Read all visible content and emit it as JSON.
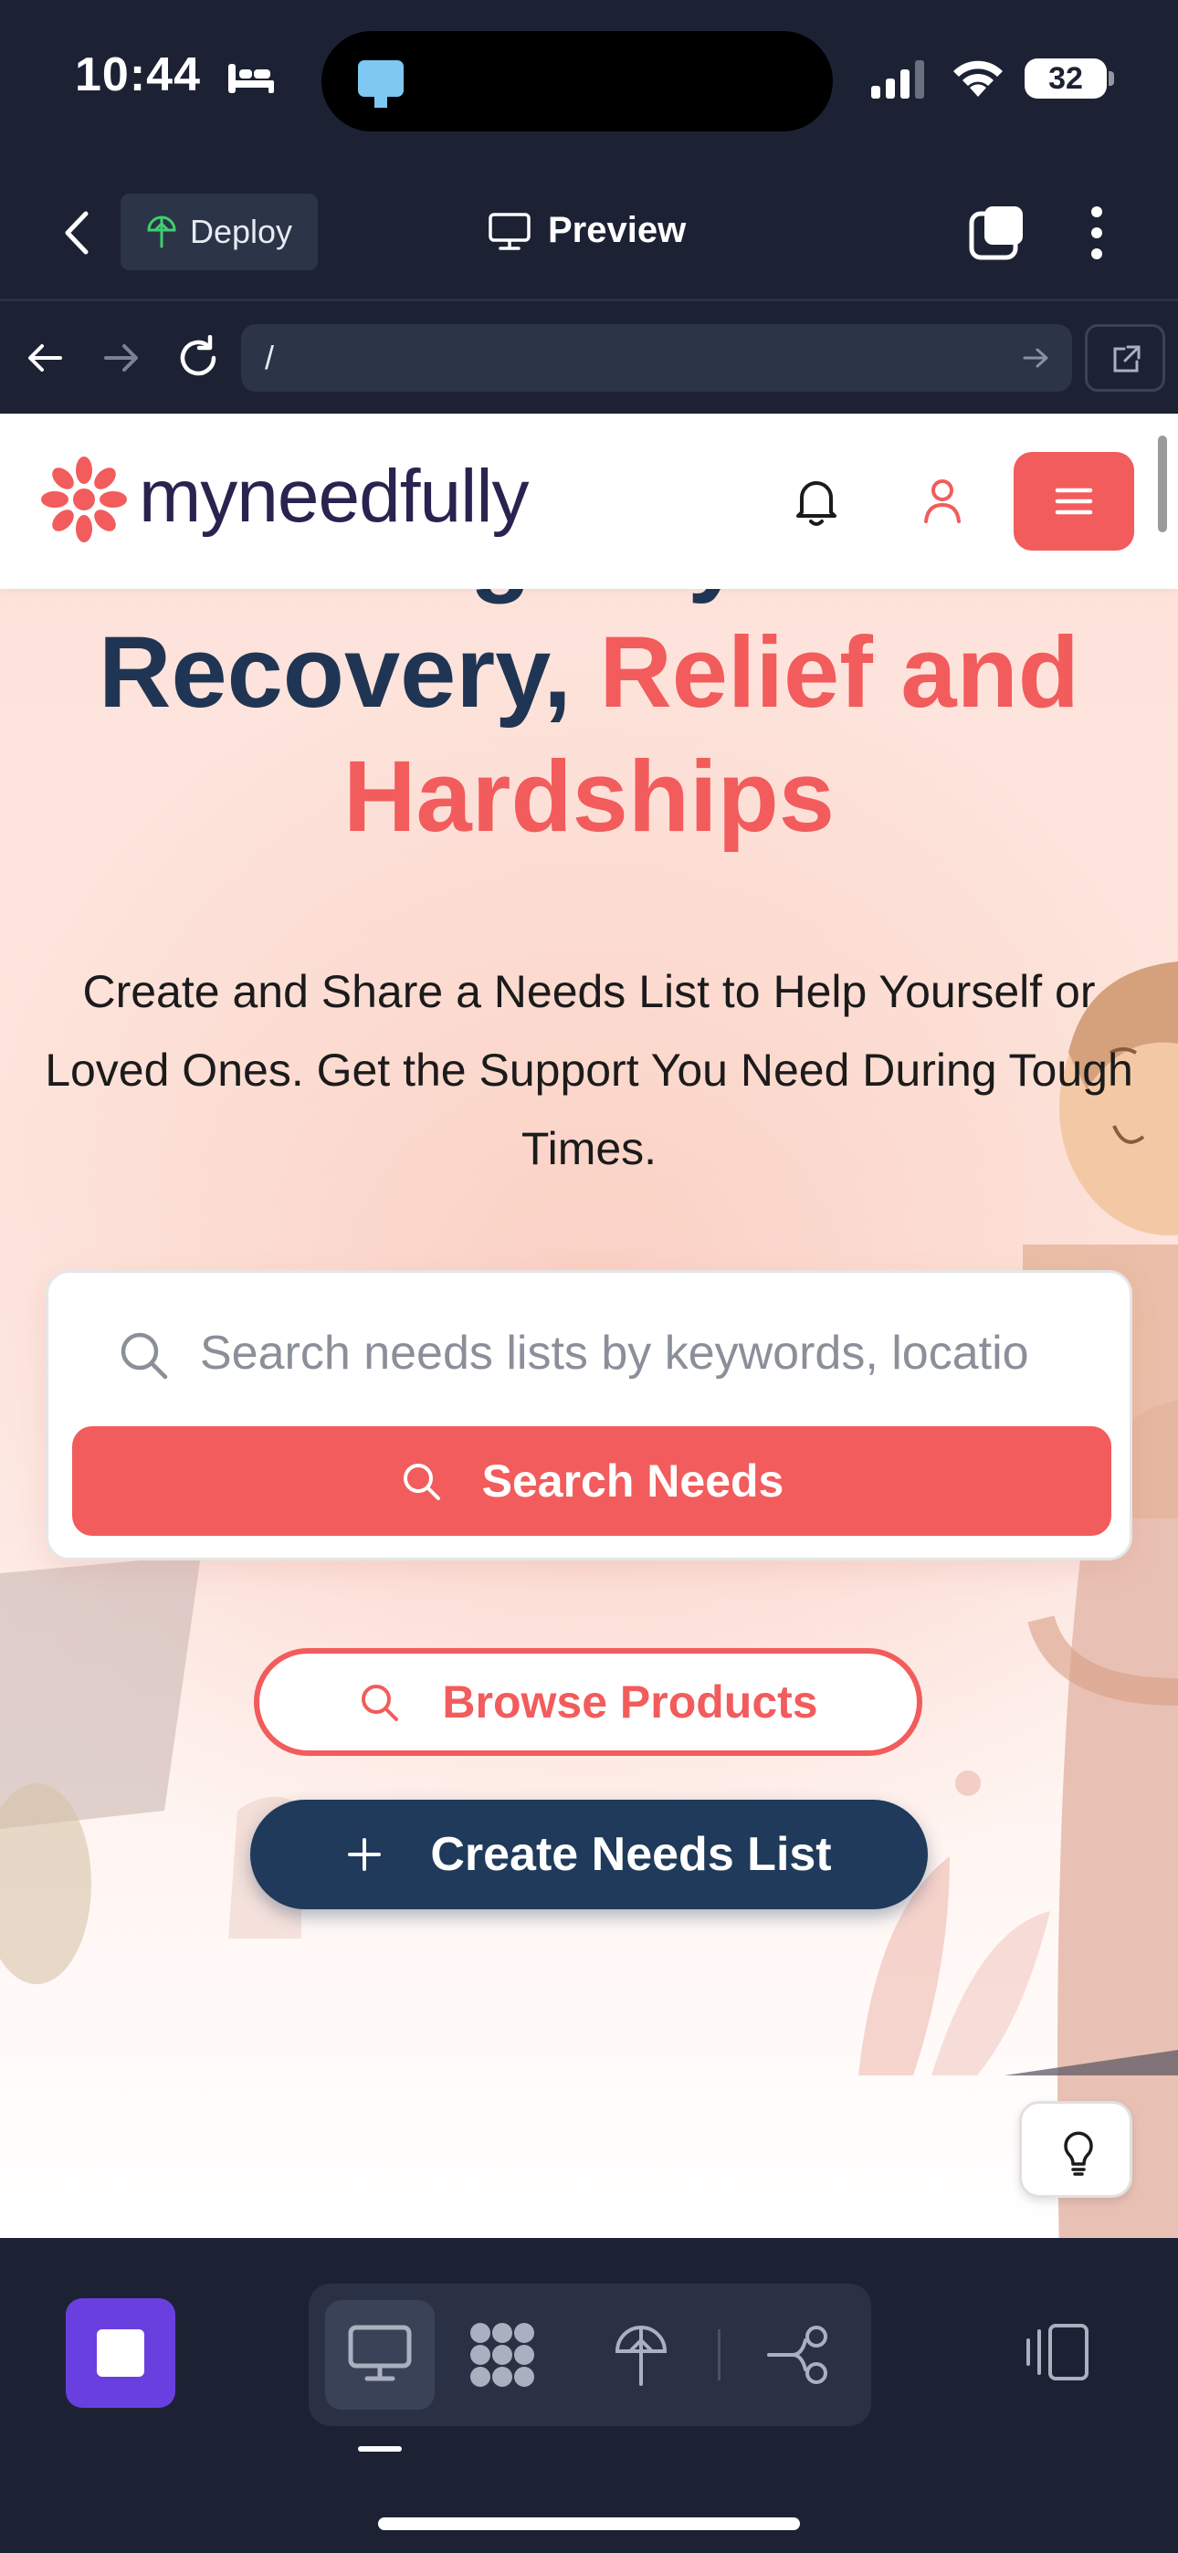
{
  "status_bar": {
    "time": "10:44",
    "battery": "32"
  },
  "editor_bar": {
    "deploy_label": "Deploy",
    "preview_label": "Preview"
  },
  "url_bar": {
    "url": "/"
  },
  "site": {
    "logo_text": "myneedfully",
    "hero": {
      "title_partial_top": "A Registry For",
      "title_line_dark": "Recovery,",
      "title_accent_1": "Relief and",
      "title_accent_2": "Hardships",
      "subtitle": "Create and Share a Needs List to Help Yourself or Loved Ones. Get the Support You Need During Tough Times."
    },
    "search": {
      "placeholder": "Search needs lists by keywords, locatio",
      "button_label": "Search Needs"
    },
    "browse_label": "Browse Products",
    "create_label": "Create Needs List"
  },
  "colors": {
    "brand_coral": "#f25c5c",
    "brand_navy": "#1f3a5a",
    "editor_bg": "#1c2234",
    "stop_purple": "#6a3fe0"
  },
  "icons": {
    "status": [
      "sleep-bed-icon",
      "cellular-signal-icon",
      "wifi-icon",
      "battery-icon"
    ],
    "editor": [
      "back-chevron-icon",
      "deploy-icon",
      "monitor-icon",
      "tabs-icon",
      "more-vertical-icon"
    ],
    "url": [
      "arrow-left-icon",
      "arrow-right-icon",
      "reload-icon",
      "go-arrow-icon",
      "external-link-icon"
    ],
    "site": [
      "logo-icon",
      "bell-icon",
      "user-icon",
      "hamburger-icon",
      "search-icon",
      "plus-icon",
      "lightbulb-icon"
    ],
    "dock": [
      "stop-icon",
      "desktop-icon",
      "grid-flower-icon",
      "deploy-icon",
      "branch-icon",
      "device-rotate-icon"
    ]
  }
}
